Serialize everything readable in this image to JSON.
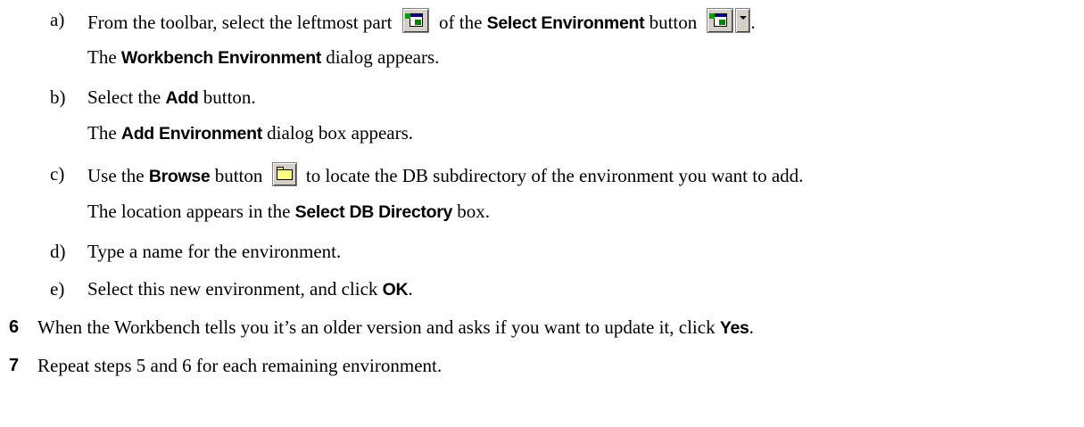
{
  "steps": {
    "a": {
      "label": "a)",
      "t1": "From the toolbar, select the leftmost part",
      "t2": "of the",
      "b1": "Select Environment",
      "t3": "button",
      "t4": ".",
      "r_t1": "The",
      "r_b1": "Workbench Environment",
      "r_t2": "dialog appears."
    },
    "b": {
      "label": "b)",
      "t1": "Select the",
      "b1": "Add",
      "t2": "button.",
      "r_t1": "The",
      "r_b1": "Add Environment",
      "r_t2": "dialog box appears."
    },
    "c": {
      "label": "c)",
      "t1": "Use the",
      "b1": "Browse",
      "t2": "button",
      "t3": "to locate the DB subdirectory of the environment you want to add.",
      "r_t1": "The location appears in the",
      "r_b1": "Select DB Directory",
      "r_t2": "box."
    },
    "d": {
      "label": "d)",
      "t1": "Type a name for the environment."
    },
    "e": {
      "label": "e)",
      "t1": "Select this new environment, and click",
      "b1": "OK",
      "t2": "."
    },
    "six": {
      "num": "6",
      "t1": "When the Workbench tells you it’s an older version and asks if you want to update it, click",
      "b1": "Yes",
      "t2": "."
    },
    "seven": {
      "num": "7",
      "t1": "Repeat steps 5 and 6 for each remaining environment."
    }
  },
  "icons": {
    "environment": "select-environment-icon",
    "dropdown": "chevron-down-icon",
    "browse": "folder-browse-icon"
  }
}
